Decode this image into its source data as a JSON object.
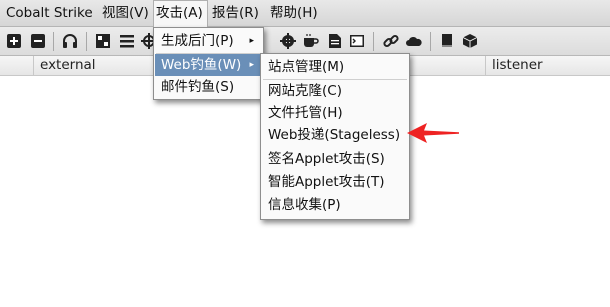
{
  "menubar": {
    "items": [
      "Cobalt Strike",
      "视图(V)",
      "攻击(A)",
      "报告(R)",
      "帮助(H)"
    ]
  },
  "table": {
    "columns": [
      "external",
      "listener"
    ]
  },
  "attack_menu": {
    "items": [
      "生成后门(P)",
      "Web钓鱼(W)",
      "邮件钓鱼(S)"
    ]
  },
  "web_menu": {
    "items": [
      "站点管理(M)",
      "网站克隆(C)",
      "文件托管(H)",
      "Web投递(Stageless)",
      "签名Applet攻击(S)",
      "智能Applet攻击(T)",
      "信息收集(P)"
    ]
  },
  "submenu_arrow": "▸",
  "colors": {
    "highlight": "#6a8fb8",
    "annotation_arrow": "#ee2222"
  }
}
